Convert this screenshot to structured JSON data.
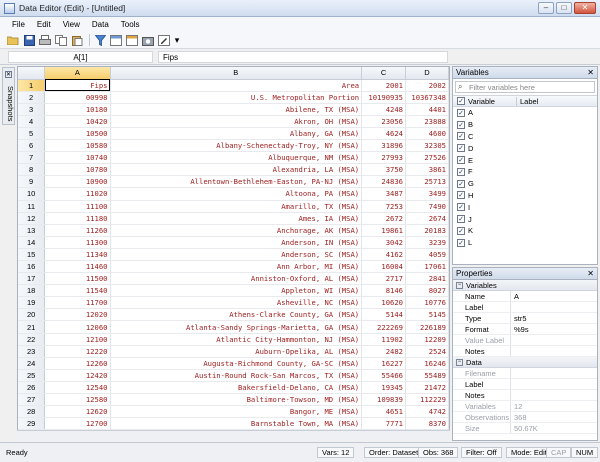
{
  "window": {
    "title": "Data Editor (Edit) - [Untitled]",
    "minimize": "–",
    "maximize": "□",
    "close": "✕"
  },
  "menu": [
    "File",
    "Edit",
    "View",
    "Data",
    "Tools"
  ],
  "toolbar_icons": [
    "open-icon",
    "save-icon",
    "print-icon",
    "copy-icon",
    "paste-icon",
    "properties-icon",
    "filter-icon",
    "variables-icon",
    "snapshot-icon",
    "edit-mode-icon",
    "overflow-icon"
  ],
  "cellbar": {
    "ref": "A[1]",
    "value": "Fips"
  },
  "side_tab": {
    "label": "Snapshots"
  },
  "grid": {
    "columns": [
      "A",
      "B",
      "C",
      "D"
    ],
    "rows": [
      [
        "1",
        "Fips",
        "Area",
        "2001",
        "2002"
      ],
      [
        "2",
        "00998",
        "U.S. Metropolitan Portion",
        "10190935",
        "10367348"
      ],
      [
        "3",
        "10180",
        "Abilene, TX (MSA)",
        "4248",
        "4401"
      ],
      [
        "4",
        "10420",
        "Akron, OH (MSA)",
        "23056",
        "23888"
      ],
      [
        "5",
        "10500",
        "Albany, GA (MSA)",
        "4624",
        "4600"
      ],
      [
        "6",
        "10580",
        "Albany-Schenectady-Troy, NY (MSA)",
        "31896",
        "32305"
      ],
      [
        "7",
        "10740",
        "Albuquerque, NM (MSA)",
        "27993",
        "27526"
      ],
      [
        "8",
        "10780",
        "Alexandria, LA (MSA)",
        "3750",
        "3861"
      ],
      [
        "9",
        "10900",
        "Allentown-Bethlehem-Easton, PA-NJ (MSA)",
        "24836",
        "25713"
      ],
      [
        "10",
        "11020",
        "Altoona, PA (MSA)",
        "3487",
        "3499"
      ],
      [
        "11",
        "11100",
        "Amarillo, TX (MSA)",
        "7253",
        "7490"
      ],
      [
        "12",
        "11180",
        "Ames, IA (MSA)",
        "2672",
        "2674"
      ],
      [
        "13",
        "11260",
        "Anchorage, AK (MSA)",
        "19861",
        "20183"
      ],
      [
        "14",
        "11300",
        "Anderson, IN (MSA)",
        "3042",
        "3239"
      ],
      [
        "15",
        "11340",
        "Anderson, SC (MSA)",
        "4162",
        "4059"
      ],
      [
        "16",
        "11460",
        "Ann Arbor, MI (MSA)",
        "16004",
        "17061"
      ],
      [
        "17",
        "11500",
        "Anniston-Oxford, AL (MSA)",
        "2717",
        "2841"
      ],
      [
        "18",
        "11540",
        "Appleton, WI (MSA)",
        "8146",
        "8027"
      ],
      [
        "19",
        "11700",
        "Asheville, NC (MSA)",
        "10620",
        "10776"
      ],
      [
        "20",
        "12020",
        "Athens-Clarke County, GA (MSA)",
        "5144",
        "5145"
      ],
      [
        "21",
        "12060",
        "Atlanta-Sandy Springs-Marietta, GA (MSA)",
        "222269",
        "226189"
      ],
      [
        "22",
        "12100",
        "Atlantic City-Hammonton, NJ (MSA)",
        "11902",
        "12209"
      ],
      [
        "23",
        "12220",
        "Auburn-Opelika, AL (MSA)",
        "2482",
        "2524"
      ],
      [
        "24",
        "12260",
        "Augusta-Richmond County, GA-SC (MSA)",
        "16227",
        "16246"
      ],
      [
        "25",
        "12420",
        "Austin-Round Rock-San Marcos, TX (MSA)",
        "55466",
        "55489"
      ],
      [
        "26",
        "12540",
        "Bakersfield-Delano, CA (MSA)",
        "19345",
        "21472"
      ],
      [
        "27",
        "12580",
        "Baltimore-Towson, MD (MSA)",
        "109839",
        "112229"
      ],
      [
        "28",
        "12620",
        "Bangor, ME (MSA)",
        "4651",
        "4742"
      ],
      [
        "29",
        "12700",
        "Barnstable Town, MA (MSA)",
        "7771",
        "8370"
      ]
    ]
  },
  "variables_panel": {
    "title": "Variables",
    "close": "✕",
    "filter_placeholder": "Filter variables here",
    "header_variable": "Variable",
    "header_label": "Label",
    "items": [
      "A",
      "B",
      "C",
      "D",
      "E",
      "F",
      "G",
      "H",
      "I",
      "J",
      "K",
      "L"
    ]
  },
  "properties_panel": {
    "title": "Properties",
    "close": "✕",
    "variables_group": "Variables",
    "variables_rows": [
      {
        "key": "Name",
        "value": "A"
      },
      {
        "key": "Label",
        "value": ""
      },
      {
        "key": "Type",
        "value": "str5"
      },
      {
        "key": "Format",
        "value": "%9s"
      },
      {
        "key": "Value Label",
        "value": ""
      },
      {
        "key": "Notes",
        "value": ""
      }
    ],
    "data_group": "Data",
    "data_rows": [
      {
        "key": "Filename",
        "value": ""
      },
      {
        "key": "Label",
        "value": ""
      },
      {
        "key": "Notes",
        "value": ""
      },
      {
        "key": "Variables",
        "value": "12"
      },
      {
        "key": "Observations",
        "value": "368"
      },
      {
        "key": "Size",
        "value": "50.67K"
      }
    ]
  },
  "status": {
    "ready": "Ready",
    "vars": "Vars: 12",
    "order": "Order: Dataset",
    "obs": "Obs: 368",
    "filter": "Filter: Off",
    "mode": "Mode: Edit",
    "cap": "CAP",
    "num": "NUM"
  },
  "colors": {
    "data_text": "#a02020",
    "selected_header": "#f5cd6c"
  }
}
